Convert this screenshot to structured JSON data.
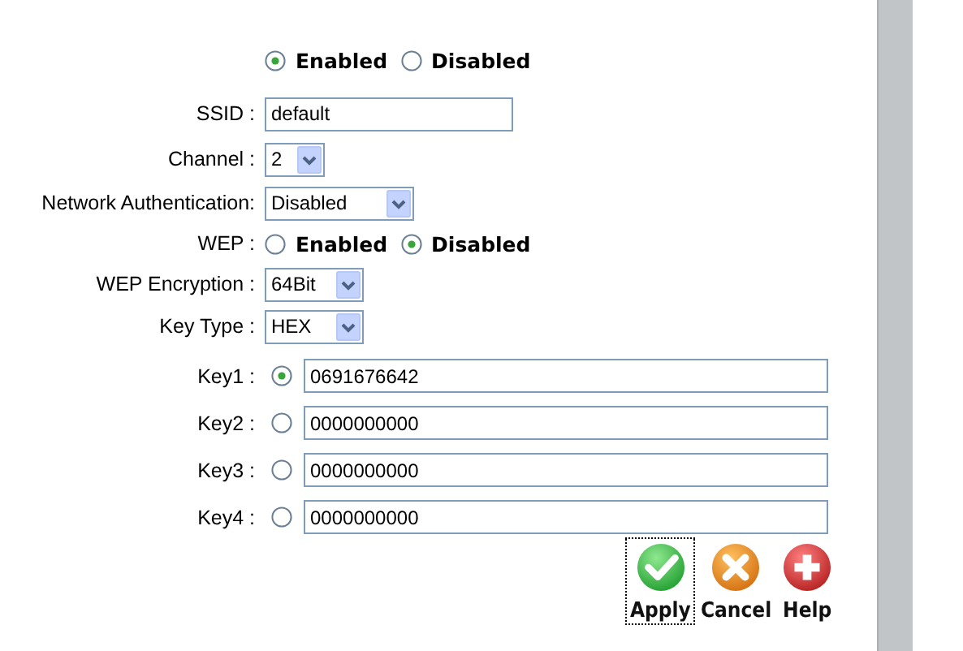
{
  "wireless": {
    "options": [
      {
        "label": "Enabled",
        "selected": true
      },
      {
        "label": "Disabled",
        "selected": false
      }
    ]
  },
  "fields": [
    {
      "kind": "text",
      "label": "SSID :",
      "value": "default"
    },
    {
      "kind": "select",
      "label": "Channel :",
      "value": "2"
    },
    {
      "kind": "select",
      "label": "Network Authentication:",
      "value": "Disabled"
    },
    {
      "kind": "radio",
      "label": "WEP :",
      "options": [
        {
          "label": "Enabled",
          "selected": false
        },
        {
          "label": "Disabled",
          "selected": true
        }
      ]
    },
    {
      "kind": "select",
      "label": "WEP Encryption :",
      "value": "64Bit"
    },
    {
      "kind": "select",
      "label": "Key Type :",
      "value": "HEX"
    }
  ],
  "keys": [
    {
      "label": "Key1 :",
      "selected": true,
      "value": "0691676642"
    },
    {
      "label": "Key2 :",
      "selected": false,
      "value": "0000000000"
    },
    {
      "label": "Key3 :",
      "selected": false,
      "value": "0000000000"
    },
    {
      "label": "Key4 :",
      "selected": false,
      "value": "0000000000"
    }
  ],
  "buttons": [
    {
      "kind": "apply",
      "label": "Apply",
      "focused": true
    },
    {
      "kind": "cancel",
      "label": "Cancel",
      "focused": false
    },
    {
      "kind": "help",
      "label": "Help",
      "focused": false
    }
  ]
}
